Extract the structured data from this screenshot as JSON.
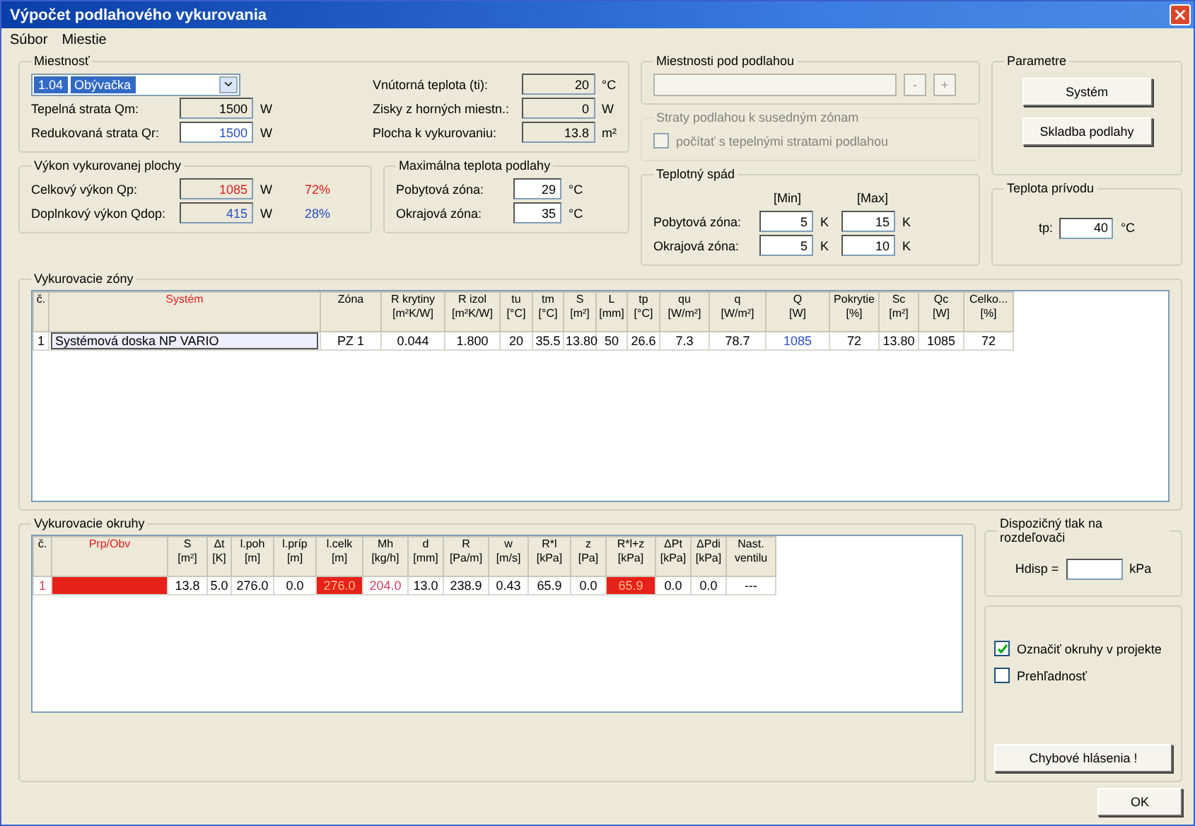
{
  "window": {
    "title": "Výpočet podlahového vykurovania"
  },
  "menu": [
    "Súbor",
    "Miestie"
  ],
  "room": {
    "legend": "Miestnosť",
    "dropdown": {
      "number": "1.04",
      "name": "Obývačka"
    },
    "left_fields": [
      {
        "label": "Tepelná strata Qm:",
        "value": "1500",
        "unit": "W",
        "editable": false
      },
      {
        "label": "Redukovaná strata Qr:",
        "value": "1500",
        "unit": "W",
        "editable": true,
        "color": "#2a4cc8"
      }
    ],
    "right_fields": [
      {
        "label": "Vnútorná teplota (ti):",
        "value": "20",
        "unit": "°C",
        "editable": false
      },
      {
        "label": "Zisky z horných miestn.:",
        "value": "0",
        "unit": "W",
        "editable": false
      },
      {
        "label": "Plocha k vykurovaniu:",
        "value": "13.8",
        "unit": "m²",
        "editable": false
      }
    ]
  },
  "below_floor": {
    "legend": "Miestnosti pod podlahou",
    "buttons": [
      "-",
      "+"
    ]
  },
  "floor_losses": {
    "legend": "Straty podlahou k susedným zónam",
    "disabled": true,
    "checkbox": {
      "label": "počítať s tepelnými stratami podlahou",
      "checked": false
    }
  },
  "parameters": {
    "legend": "Parametre",
    "buttons": [
      "Systém",
      "Skladba podlahy"
    ]
  },
  "output": {
    "legend": "Výkon vykurovanej plochy",
    "rows": [
      {
        "label": "Celkový výkon Qp:",
        "value": "1085",
        "unit": "W",
        "percent": "72%",
        "color": "#e02020"
      },
      {
        "label": "Doplnkový výkon Qdop:",
        "value": "415",
        "unit": "W",
        "percent": "28%",
        "color": "#2a4cc8"
      }
    ]
  },
  "max_floor_temp": {
    "legend": "Maximálna teplota podlahy",
    "fields": [
      {
        "label": "Pobytová zóna:",
        "value": "29",
        "unit": "°C",
        "editable": true
      },
      {
        "label": "Okrajová zóna:",
        "value": "35",
        "unit": "°C",
        "editable": true
      }
    ]
  },
  "temp_drop": {
    "legend": "Teplotný spád",
    "min_label": "[Min]",
    "max_label": "[Max]",
    "rows": [
      {
        "label": "Pobytová zóna:",
        "min": {
          "value": "5",
          "unit": "K"
        },
        "max": {
          "value": "15",
          "unit": "K"
        }
      },
      {
        "label": "Okrajová zóna:",
        "min": {
          "value": "5",
          "unit": "K"
        },
        "max": {
          "value": "10",
          "unit": "K"
        }
      }
    ]
  },
  "supply_temp": {
    "legend": "Teplota prívodu",
    "label": "tp:",
    "value": "40",
    "unit": "°C"
  },
  "zones": {
    "legend": "Vykurovacie zóny",
    "columns": [
      {
        "label": "č."
      },
      {
        "label": "Systém",
        "color": "#e02020"
      },
      {
        "label": "Zóna"
      },
      {
        "label": "R krytiny",
        "unit": "[m²K/W]"
      },
      {
        "label": "R izol",
        "unit": "[m²K/W]"
      },
      {
        "label": "tu",
        "unit": "[°C]"
      },
      {
        "label": "tm",
        "unit": "[°C]"
      },
      {
        "label": "S",
        "unit": "[m²]"
      },
      {
        "label": "L",
        "unit": "[mm]"
      },
      {
        "label": "tp",
        "unit": "[°C]"
      },
      {
        "label": "qu",
        "unit": "[W/m²]"
      },
      {
        "label": "q",
        "unit": "[W/m²]"
      },
      {
        "label": "Q",
        "unit": "[W]"
      },
      {
        "label": "Pokrytie",
        "unit": "[%]"
      },
      {
        "label": "Sc",
        "unit": "[m²]"
      },
      {
        "label": "Qc",
        "unit": "[W]"
      },
      {
        "label": "Celko...",
        "unit": "[%]"
      }
    ],
    "rows": [
      {
        "cells": [
          {
            "text": "1"
          },
          {
            "text": "Systémová doska NP VARIO",
            "kind": "select"
          },
          {
            "text": "PZ 1"
          },
          {
            "text": "0.044"
          },
          {
            "text": "1.800"
          },
          {
            "text": "20"
          },
          {
            "text": "35.5"
          },
          {
            "text": "13.80"
          },
          {
            "text": "50"
          },
          {
            "text": "26.6"
          },
          {
            "text": "7.3"
          },
          {
            "text": "78.7"
          },
          {
            "text": "1085",
            "color": "#2a4cc8"
          },
          {
            "text": "72"
          },
          {
            "text": "13.80"
          },
          {
            "text": "1085"
          },
          {
            "text": "72"
          }
        ]
      }
    ]
  },
  "circuits": {
    "legend": "Vykurovacie okruhy",
    "columns": [
      {
        "label": "č."
      },
      {
        "label": "Prp/Obv",
        "color": "#e02020"
      },
      {
        "label": "S",
        "unit": "[m²]"
      },
      {
        "label": "Δt",
        "unit": "[K]"
      },
      {
        "label": "l.poh",
        "unit": "[m]"
      },
      {
        "label": "l.príp",
        "unit": "[m]"
      },
      {
        "label": "l.celk",
        "unit": "[m]"
      },
      {
        "label": "Mh",
        "unit": "[kg/h]"
      },
      {
        "label": "d",
        "unit": "[mm]"
      },
      {
        "label": "R",
        "unit": "[Pa/m]"
      },
      {
        "label": "w",
        "unit": "[m/s]"
      },
      {
        "label": "R*l",
        "unit": "[kPa]"
      },
      {
        "label": "z",
        "unit": "[Pa]"
      },
      {
        "label": "R*l+z",
        "unit": "[kPa]"
      },
      {
        "label": "ΔPt",
        "unit": "[kPa]"
      },
      {
        "label": "ΔPdi",
        "unit": "[kPa]"
      },
      {
        "label": "Nast.",
        "unit": "ventilu"
      }
    ],
    "rows": [
      {
        "cells": [
          {
            "text": "1",
            "color": "#d04060"
          },
          {
            "highlighted": true
          },
          {
            "text": "13.8"
          },
          {
            "text": "5.0"
          },
          {
            "text": "276.0"
          },
          {
            "text": "0.0"
          },
          {
            "text": "276.0",
            "highlighted": true
          },
          {
            "text": "204.0",
            "color": "#d04060"
          },
          {
            "text": "13.0"
          },
          {
            "text": "238.9"
          },
          {
            "text": "0.43"
          },
          {
            "text": "65.9"
          },
          {
            "text": "0.0"
          },
          {
            "text": "65.9",
            "highlighted": true
          },
          {
            "text": "0.0"
          },
          {
            "text": "0.0"
          },
          {
            "text": "---"
          }
        ]
      }
    ]
  },
  "pressure": {
    "legend": "Dispozičný tlak na rozdeľovači",
    "label": "Hdisp =",
    "unit": "kPa"
  },
  "options": [
    {
      "label": "Označiť okruhy v projekte",
      "checked": true
    },
    {
      "label": "Prehľadnosť",
      "checked": false
    }
  ],
  "error_button": "Chybové hlásenia !",
  "ok_button": "OK"
}
